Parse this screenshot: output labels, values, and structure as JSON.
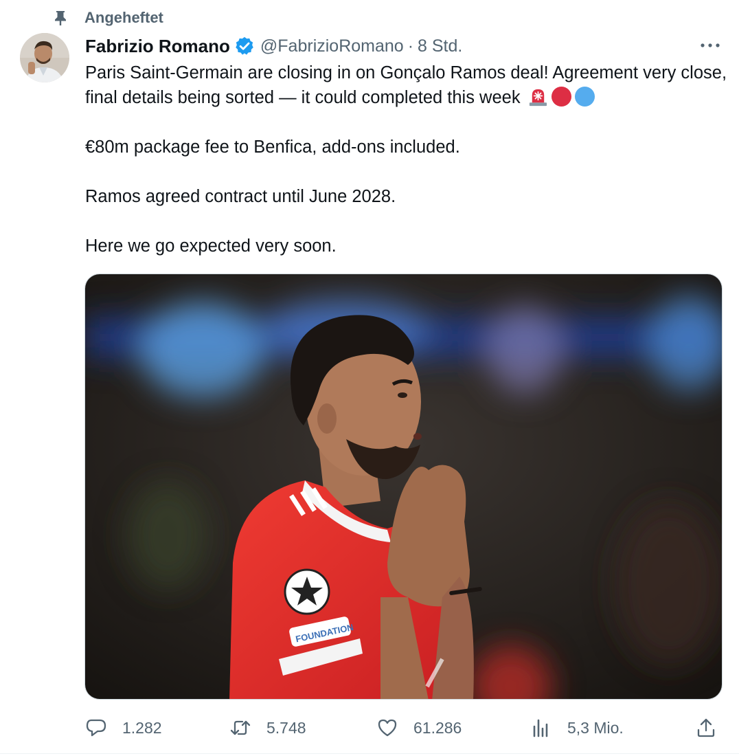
{
  "pinned": {
    "label": "Angeheftet"
  },
  "author": {
    "name": "Fabrizio Romano",
    "handle": "@FabrizioRomano",
    "separator": "·",
    "time": "8 Std."
  },
  "tweet": {
    "paragraphs": [
      "Paris Saint-Germain are closing in on Gonçalo Ramos deal! Agreement very close, final details being sorted — it could completed this week",
      "€80m package fee to Benfica, add-ons included.",
      "Ramos agreed contract until June 2028.",
      "Here we go expected very soon."
    ],
    "emojis": [
      "rotating-light",
      "red-circle",
      "blue-circle"
    ]
  },
  "media": {
    "badge_text": "FOUNDATION"
  },
  "actions": {
    "replies": "1.282",
    "reposts": "5.748",
    "likes": "61.286",
    "views": "5,3 Mio."
  },
  "colors": {
    "text": "#0f1419",
    "secondary": "#536471",
    "verified": "#1d9bf0",
    "red_circle": "#dd2e44",
    "blue_circle": "#55acee",
    "jersey_red": "#e03030"
  }
}
